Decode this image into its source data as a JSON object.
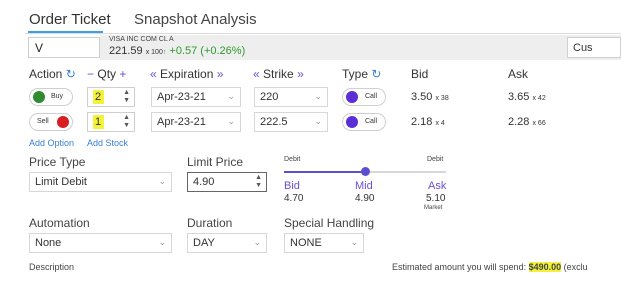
{
  "tabs": [
    {
      "label": "Order Ticket"
    },
    {
      "label": "Snapshot Analysis"
    }
  ],
  "symbol": {
    "value": "V"
  },
  "quote": {
    "name": "VISA INC COM CL A",
    "price": "221.59",
    "size": "x 100",
    "tick": "↑",
    "change": "+0.57 (+0.26%)"
  },
  "order_type_partial": "Cus",
  "headers": {
    "action": "Action",
    "qty": "Qty",
    "expiration": "Expiration",
    "strike": "Strike",
    "type": "Type",
    "bid": "Bid",
    "ask": "Ask",
    "minus": "−",
    "plus": "+",
    "dbl_left": "«",
    "dbl_right": "»",
    "refresh": "↻"
  },
  "legs": [
    {
      "action": "Buy",
      "action_color": "#2e8b2e",
      "qty": "2",
      "expiration": "Apr-23-21",
      "strike": "220",
      "type": "Call",
      "type_color": "#5b2fd8",
      "bid": "3.50",
      "bid_size": "x 38",
      "ask": "3.65",
      "ask_size": "x 42"
    },
    {
      "action": "Sell",
      "action_color": "#d81f1f",
      "qty": "1",
      "expiration": "Apr-23-21",
      "strike": "222.5",
      "type": "Call",
      "type_color": "#5b2fd8",
      "bid": "2.18",
      "bid_size": "x 4",
      "ask": "2.28",
      "ask_size": "x 66"
    }
  ],
  "links": {
    "add_option": "Add Option",
    "add_stock": "Add Stock"
  },
  "price_type": {
    "label": "Price Type",
    "value": "Limit Debit"
  },
  "limit_price": {
    "label": "Limit Price",
    "value": "4.90"
  },
  "slider": {
    "left_label": "Debit",
    "right_label": "Debit",
    "position": 0.5,
    "bid": {
      "label": "Bid",
      "value": "4.70"
    },
    "mid": {
      "label": "Mid",
      "value": "4.90"
    },
    "ask": {
      "label": "Ask",
      "value": "5.10",
      "sub": "Market"
    }
  },
  "automation": {
    "label": "Automation",
    "value": "None"
  },
  "duration": {
    "label": "Duration",
    "value": "DAY"
  },
  "special_handling": {
    "label": "Special Handling",
    "value": "NONE"
  },
  "description_label": "Description",
  "estimate": {
    "prefix": "Estimated amount you will spend: ",
    "amount": "$490.00",
    "suffix": " (exclu"
  },
  "colors": {
    "accent": "#5b4fd0",
    "link": "#3a7fd4",
    "highlight": "#f3f23a",
    "gain": "#2e9a2e"
  }
}
